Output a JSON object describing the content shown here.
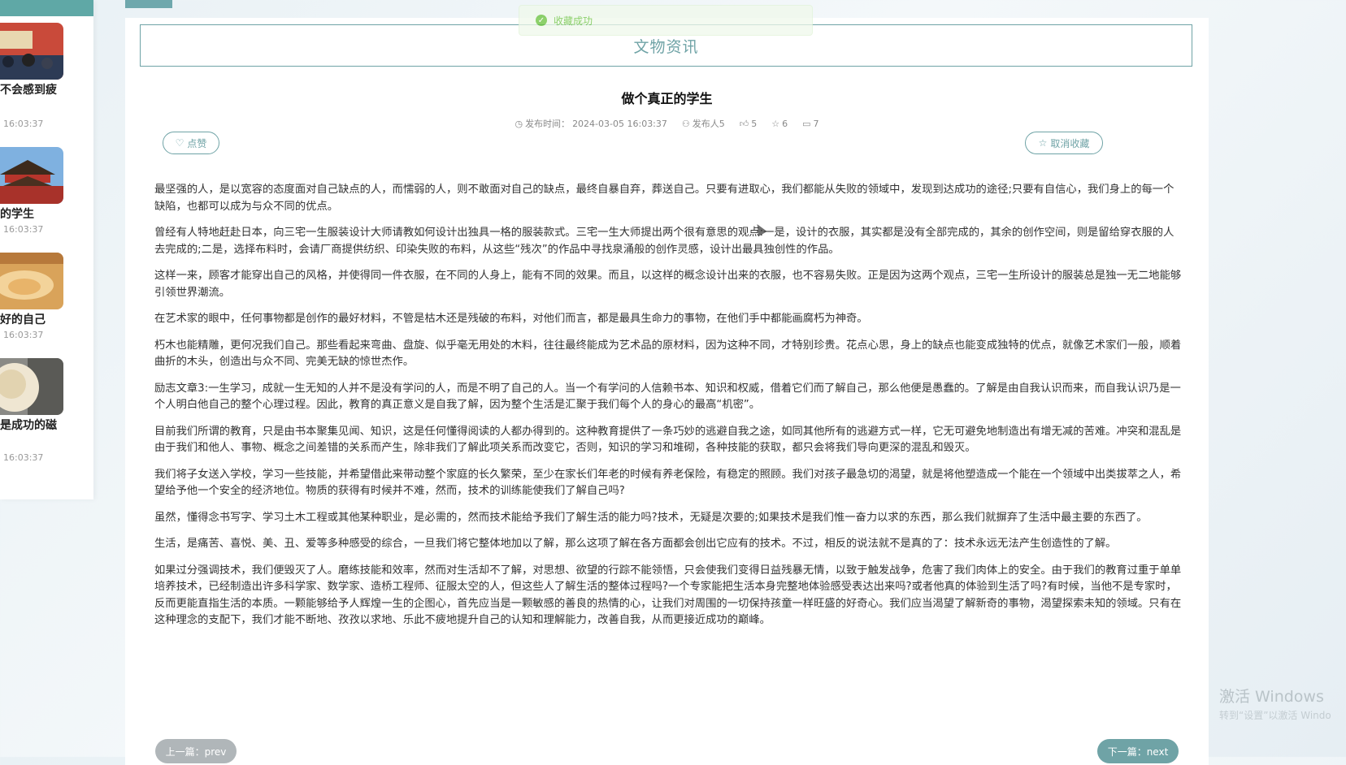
{
  "toast": {
    "text": "收藏成功"
  },
  "section": {
    "title": "文物资讯"
  },
  "sidebar": {
    "items": [
      {
        "title": "不会感到疲",
        "time": "16:03:37"
      },
      {
        "title": "的学生",
        "time": "16:03:37"
      },
      {
        "title": "好的自己",
        "time": "16:03:37"
      },
      {
        "title": "是成功的磁",
        "time": "16:03:37"
      }
    ]
  },
  "article": {
    "title": "做个真正的学生",
    "meta": {
      "publish_label": "发布时间：",
      "publish_time": "2024-03-05 16:03:37",
      "author": "发布人5",
      "likes": "5",
      "favorites": "6",
      "comments": "7"
    },
    "like_label": "点赞",
    "unfavorite_label": "取消收藏",
    "paragraphs": [
      "最坚强的人，是以宽容的态度面对自己缺点的人，而懦弱的人，则不敢面对自己的缺点，最终自暴自弃，葬送自己。只要有进取心，我们都能从失败的领域中，发现到达成功的途径;只要有自信心，我们身上的每一个缺陷，也都可以成为与众不同的优点。",
      "曾经有人特地赶赴日本，向三宅一生服装设计大师请教如何设计出独具一格的服装款式。三宅一生大师提出两个很有意思的观点:一是，设计的衣服，其实都是没有全部完成的，其余的创作空间，则是留给穿衣服的人去完成的;二是，选择布料时，会请厂商提供纺织、印染失败的布料，从这些“残次”的作品中寻找泉涌般的创作灵感，设计出最具独创性的作品。",
      "这样一来，顾客才能穿出自己的风格，并使得同一件衣服，在不同的人身上，能有不同的效果。而且，以这样的概念设计出来的衣服，也不容易失败。正是因为这两个观点，三宅一生所设计的服装总是独一无二地能够引领世界潮流。",
      "在艺术家的眼中，任何事物都是创作的最好材料，不管是枯木还是残破的布料，对他们而言，都是最具生命力的事物，在他们手中都能画腐朽为神奇。",
      "朽木也能精雕，更何况我们自己。那些看起来弯曲、盘旋、似乎毫无用处的木料，往往最终能成为艺术品的原材料，因为这种不同，才特别珍贵。花点心思，身上的缺点也能变成独特的优点，就像艺术家们一般，顺着曲折的木头，创造出与众不同、完美无缺的惊世杰作。",
      "励志文章3:一生学习，成就一生无知的人并不是没有学问的人，而是不明了自己的人。当一个有学问的人信赖书本、知识和权威，借着它们而了解自己，那么他便是愚蠢的。了解是由自我认识而来，而自我认识乃是一个人明白他自己的整个心理过程。因此，教育的真正意义是自我了解，因为整个生活是汇聚于我们每个人的身心的最高“机密”。",
      "目前我们所谓的教育，只是由书本聚集见闻、知识，这是任何懂得阅读的人都办得到的。这种教育提供了一条巧妙的逃避自我之途，如同其他所有的逃避方式一样，它无可避免地制造出有增无减的苦难。冲突和混乱是由于我们和他人、事物、概念之间差错的关系而产生，除非我们了解此项关系而改变它，否则，知识的学习和堆砌，各种技能的获取，都只会将我们导向更深的混乱和毁灭。",
      "我们将子女送入学校，学习一些技能，并希望借此来带动整个家庭的长久繁荣，至少在家长们年老的时候有养老保险，有稳定的照顾。我们对孩子最急切的渴望，就是将他塑造成一个能在一个领域中出类拔萃之人，希望给予他一个安全的经济地位。物质的获得有时候并不难，然而，技术的训练能使我们了解自己吗?",
      "虽然，懂得念书写字、学习土木工程或其他某种职业，是必需的，然而技术能给予我们了解生活的能力吗?技术，无疑是次要的;如果技术是我们惟一奋力以求的东西，那么我们就摒弃了生活中最主要的东西了。",
      "生活，是痛苦、喜悦、美、丑、爱等多种感受的综合，一旦我们将它整体地加以了解，那么这项了解在各方面都会创出它应有的技术。不过，相反的说法就不是真的了：技术永远无法产生创造性的了解。",
      "如果过分强调技术，我们便毁灭了人。磨练技能和效率，然而对生活却不了解，对思想、欲望的行踪不能领悟，只会使我们变得日益残暴无情，以致于触发战争，危害了我们肉体上的安全。由于我们的教育过重于单单培养技术，已经制造出许多科学家、数学家、造桥工程师、征服太空的人，但这些人了解生活的整体过程吗?一个专家能把生活本身完整地体验感受表达出来吗?或者他真的体验到生活了吗?有时候，当他不是专家时，反而更能直指生活的本质。一颗能够给予人辉煌一生的企图心，首先应当是一颗敏感的善良的热情的心，让我们对周围的一切保持孩童一样旺盛的好奇心。我们应当渴望了解新奇的事物，渴望探索未知的领域。只有在这种理念的支配下，我们才能不断地、孜孜以求地、乐此不疲地提升自己的认知和理解能力，改善自我，从而更接近成功的巅峰。"
    ]
  },
  "nav": {
    "prev": "上一篇：prev",
    "next": "下一篇：next"
  },
  "watermark": {
    "line1": "激活 Windows",
    "line2": "转到“设置”以激活 Windo"
  },
  "colors": {
    "accent": "#6fa3a6",
    "success": "#67c23a",
    "nav_prev": "#b0b6b9",
    "nav_next": "#6fa3a6"
  }
}
